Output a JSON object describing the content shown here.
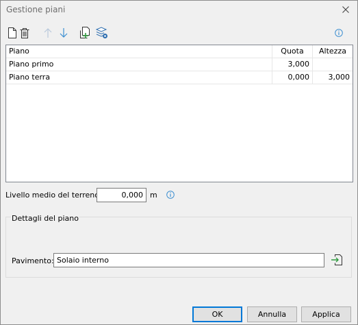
{
  "window": {
    "title": "Gestione piani"
  },
  "toolbar": {
    "icons": [
      "new-document-icon",
      "delete-icon",
      "move-up-icon",
      "move-down-icon",
      "add-floor-icon",
      "layers-settings-icon",
      "info-icon"
    ],
    "accent": "#3d8fd1"
  },
  "table": {
    "columns": [
      "Piano",
      "Quota",
      "Altezza"
    ],
    "rows": [
      {
        "piano": "Piano primo",
        "quota": "3,000",
        "altezza": ""
      },
      {
        "piano": "Piano terra",
        "quota": "0,000",
        "altezza": "3,000"
      }
    ]
  },
  "terrain": {
    "label": "Livello medio del terreno:",
    "value": "0,000",
    "unit": "m"
  },
  "details": {
    "legend": "Dettagli del piano",
    "floor_label": "Pavimento:",
    "floor_value": "Solaio interno"
  },
  "buttons": {
    "ok": "OK",
    "cancel": "Annulla",
    "apply": "Applica"
  }
}
